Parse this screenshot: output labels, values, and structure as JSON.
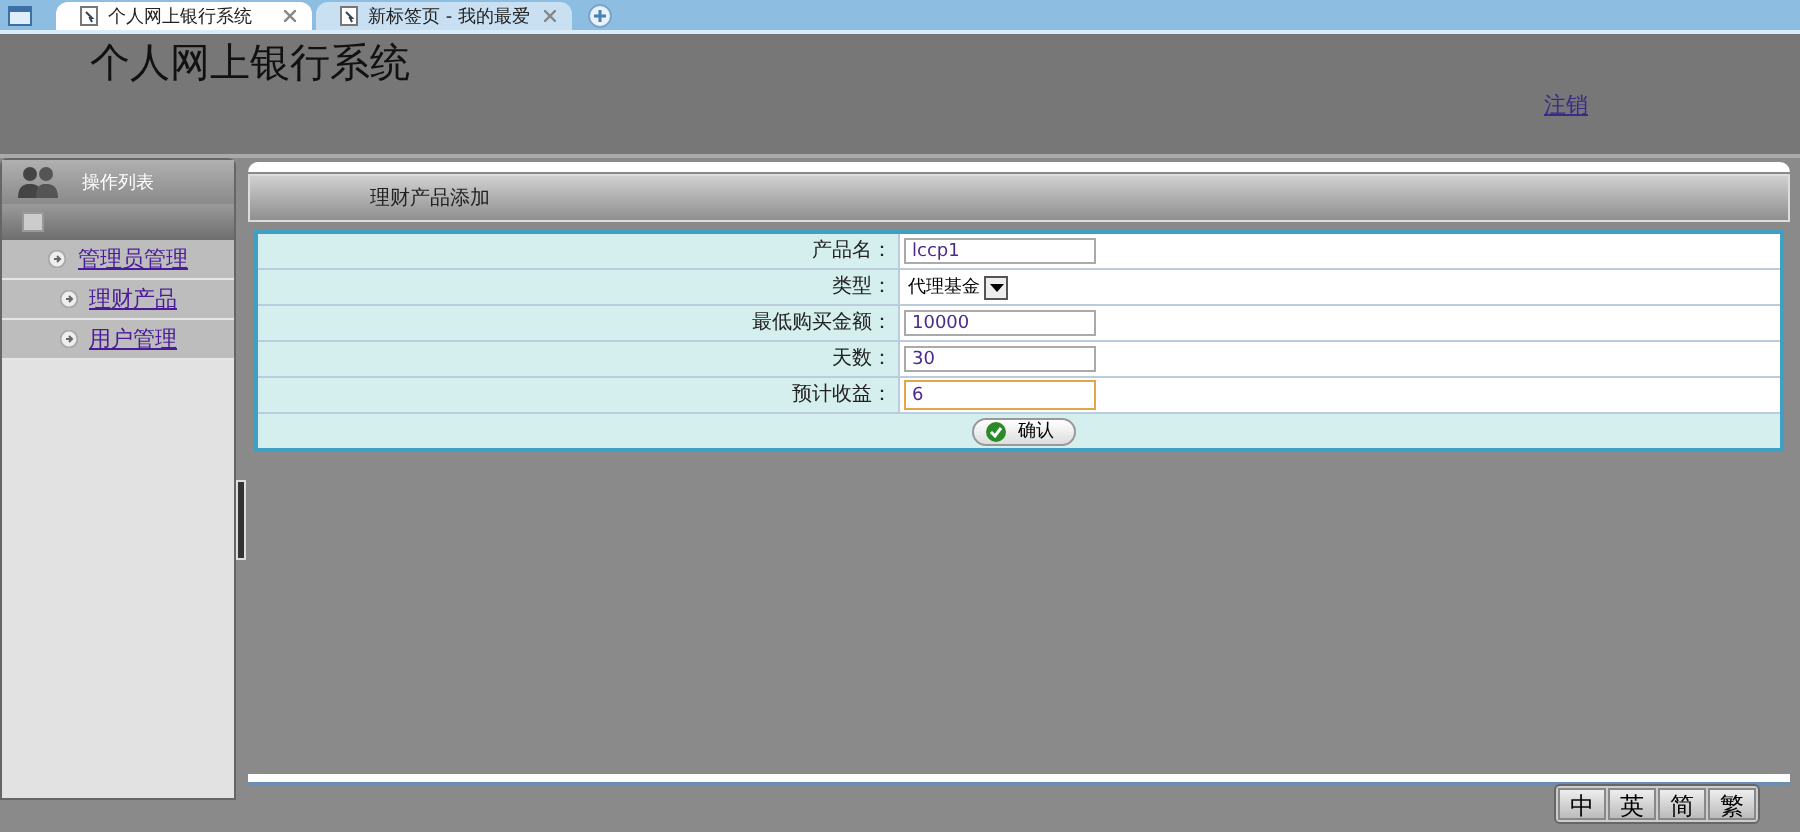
{
  "browser_tabs": [
    {
      "title": "个人网上银行系统",
      "selected": true
    },
    {
      "title": "新标签页 - 我的最爱",
      "selected": false
    }
  ],
  "header": {
    "title": "个人网上银行系统",
    "logout": "注销"
  },
  "sidebar": {
    "title": "操作列表",
    "items": [
      {
        "label": "管理员管理"
      },
      {
        "label": "理财产品"
      },
      {
        "label": "用户管理"
      }
    ]
  },
  "panel": {
    "title": "理财产品添加",
    "fields": [
      {
        "label": "产品名：",
        "kind": "text",
        "value": "lccp1",
        "focused": false
      },
      {
        "label": "类型：",
        "kind": "select",
        "value": "代理基金",
        "focused": false
      },
      {
        "label": "最低购买金额：",
        "kind": "text",
        "value": "10000",
        "focused": false
      },
      {
        "label": "天数：",
        "kind": "text",
        "value": "30",
        "focused": false
      },
      {
        "label": "预计收益：",
        "kind": "text",
        "value": "6",
        "focused": true
      }
    ],
    "submit": "确认"
  },
  "ime_bar": [
    "中",
    "英",
    "简",
    "繁"
  ]
}
